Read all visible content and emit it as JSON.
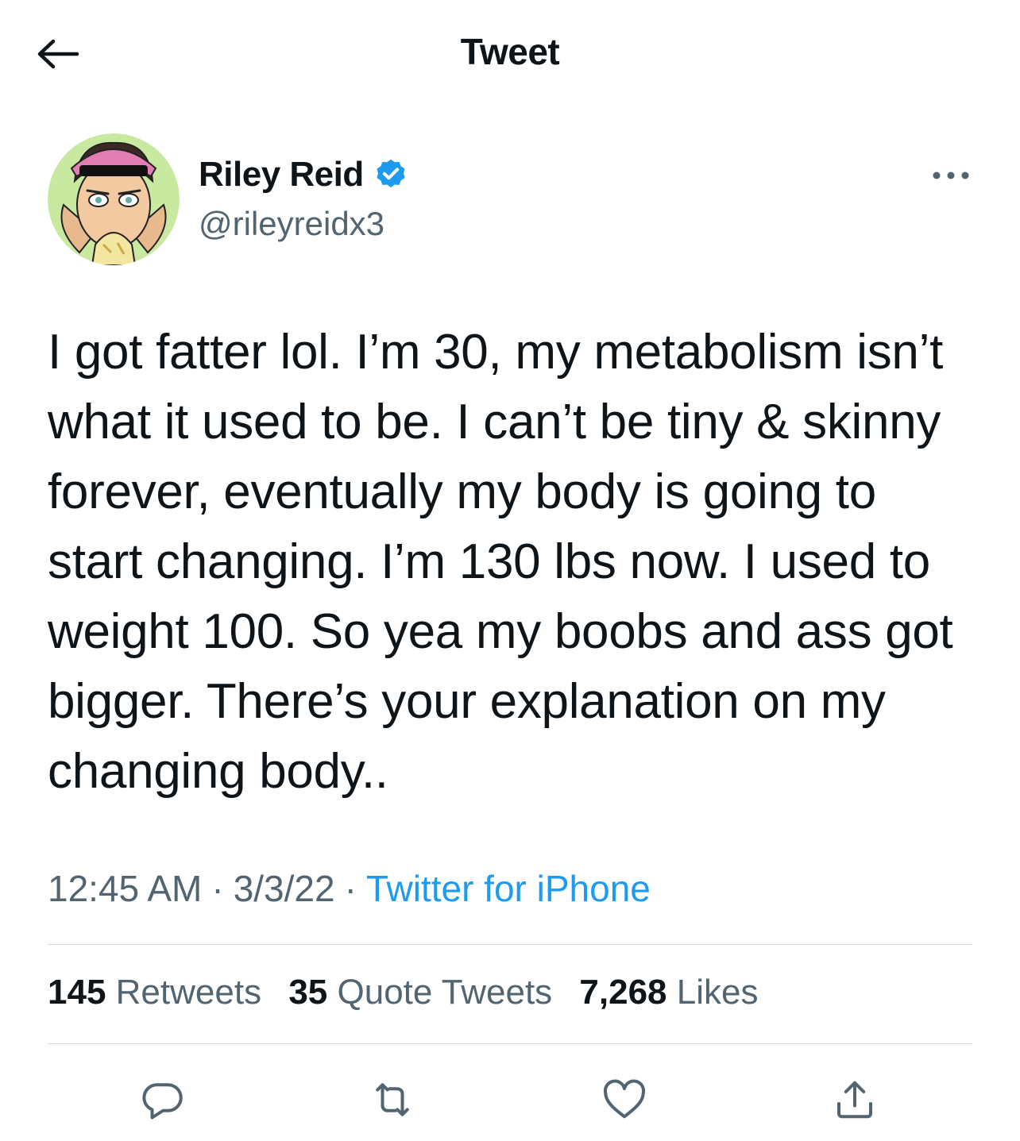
{
  "header": {
    "title": "Tweet",
    "back_icon": "arrow-left-icon"
  },
  "author": {
    "display_name": "Riley Reid",
    "handle": "@rileyreidx3",
    "verified": true,
    "verified_icon": "verified-badge-icon",
    "avatar": "cartoon-avatar"
  },
  "tweet": {
    "text": "I got fatter lol. I’m 30, my metabolism isn’t what it used to be. I can’t be tiny & skinny forever, eventually my body is going to start changing. I’m 130 lbs now. I used to weight 100. So yea my boobs and ass got bigger. There’s your explanation on my changing body..",
    "time": "12:45 AM",
    "date": "3/3/22",
    "separator": "·",
    "source": "Twitter for iPhone"
  },
  "stats": {
    "retweets_count": "145",
    "retweets_label": "Retweets",
    "quotes_count": "35",
    "quotes_label": "Quote Tweets",
    "likes_count": "7,268",
    "likes_label": "Likes"
  },
  "actions": [
    "reply-icon",
    "retweet-icon",
    "like-icon",
    "share-icon"
  ],
  "colors": {
    "text": "#0f1419",
    "secondary": "#536471",
    "link": "#1d9bf0",
    "divider": "#cfd9de",
    "verified": "#1d9bf0"
  }
}
